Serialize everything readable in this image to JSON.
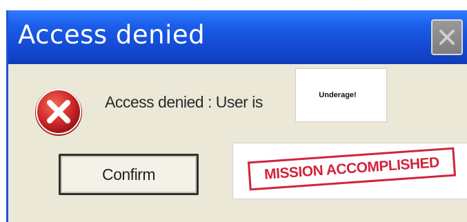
{
  "dialog": {
    "title": "Access denied",
    "message": "Access denied : User is",
    "reason": "Underage!",
    "confirm_label": "Confirm",
    "stamp_text": "MISSION ACCOMPLISHED"
  },
  "icons": {
    "close": "close-icon",
    "error": "error-icon"
  },
  "colors": {
    "titlebar": "#1a5de8",
    "window_body": "#ebe8d8",
    "stamp": "#d1243a",
    "error_red": "#d22b2b"
  }
}
